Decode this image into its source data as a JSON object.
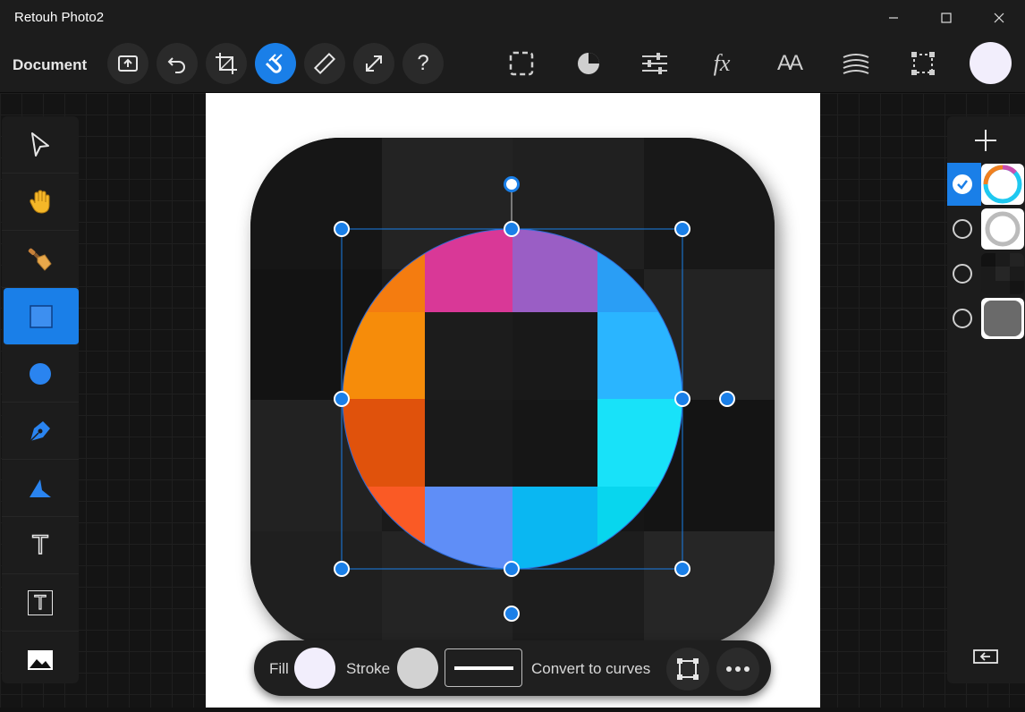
{
  "window": {
    "title": "Retouh Photo2",
    "minimize_icon": "minimize-icon",
    "maximize_icon": "maximize-icon",
    "close_icon": "close-icon"
  },
  "toolbar": {
    "document_label": "Document",
    "left_buttons": [
      {
        "name": "export-icon"
      },
      {
        "name": "undo-icon"
      },
      {
        "name": "crop-icon"
      },
      {
        "name": "snap-magnet-icon",
        "active": true
      },
      {
        "name": "ruler-icon"
      },
      {
        "name": "resize-icon"
      },
      {
        "name": "help-icon",
        "glyph": "?"
      }
    ],
    "right_icons": [
      "selection-icon",
      "pie-icon",
      "adjustments-icon",
      "effects-fx-icon",
      "text-style-icon",
      "texture-icon",
      "transform-icon"
    ],
    "fx_label": "fx",
    "text_style_label": "AA"
  },
  "tools": [
    {
      "name": "cursor-tool"
    },
    {
      "name": "hand-tool"
    },
    {
      "name": "brush-tool"
    },
    {
      "name": "rectangle-tool",
      "active": true
    },
    {
      "name": "ellipse-tool"
    },
    {
      "name": "pen-tool"
    },
    {
      "name": "node-tool"
    },
    {
      "name": "text-tool",
      "glyph": "T"
    },
    {
      "name": "textframe-tool",
      "glyph": "T"
    },
    {
      "name": "image-tool"
    }
  ],
  "layers": [
    {
      "name": "ring-layer",
      "selected": true
    },
    {
      "name": "white-ring-layer",
      "selected": false
    },
    {
      "name": "dark-squares-layer",
      "selected": false
    },
    {
      "name": "rounded-bg-layer",
      "selected": false
    }
  ],
  "bottom_bar": {
    "fill_label": "Fill",
    "fill_color": "#f2eefc",
    "stroke_label": "Stroke",
    "stroke_color": "#d2d2d2",
    "convert_label": "Convert to curves"
  },
  "colors": {
    "accent": "#1a7fe8"
  }
}
